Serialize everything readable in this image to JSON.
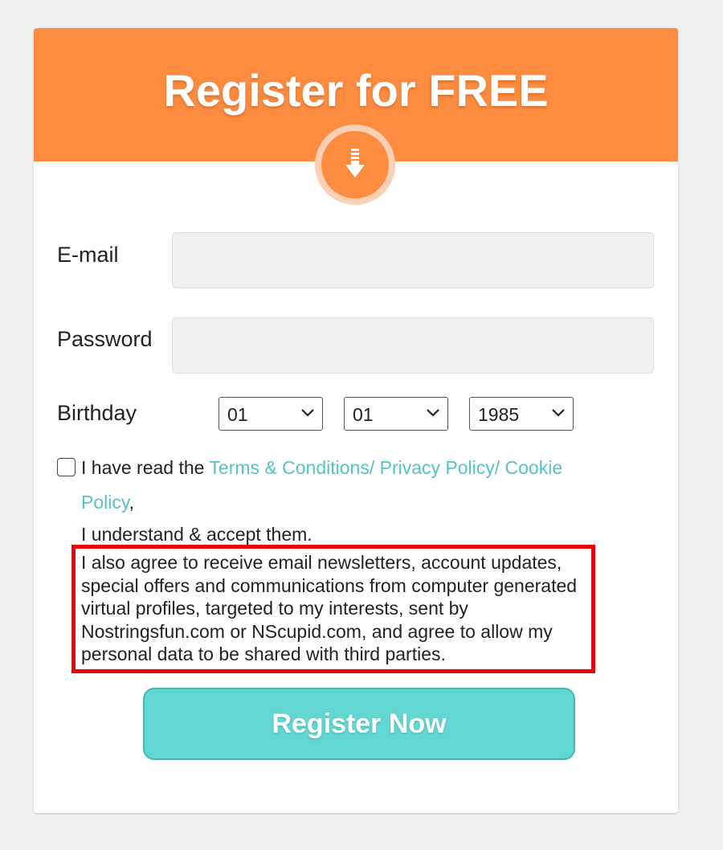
{
  "header": {
    "title": "Register for FREE",
    "badge_icon": "download-arrow-icon",
    "color": "#fe8c40"
  },
  "form": {
    "email_label": "E-mail",
    "email_value": "",
    "password_label": "Password",
    "password_value": "",
    "birthday_label": "Birthday",
    "birthday_day": "01",
    "birthday_month": "01",
    "birthday_year": "1985"
  },
  "consent": {
    "checked": false,
    "prefix": "I have read the ",
    "link_text": "Terms & Conditions/ Privacy Policy/ Cookie Policy",
    "suffix": ",",
    "understand": "I understand & accept them.",
    "agree_text": "I also agree to receive email newsletters, account updates, special offers and communications from computer generated virtual profiles, targeted to my interests, sent by Nostringsfun.com or NScupid.com, and agree to allow my personal data to be shared with third parties.",
    "highlight_color": "#e8040e",
    "link_color": "#55c2c6"
  },
  "register_button": {
    "label": "Register Now",
    "color": "#62d6d2"
  }
}
